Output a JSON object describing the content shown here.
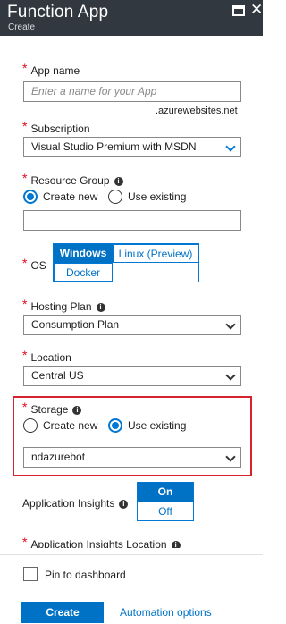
{
  "header": {
    "title": "Function App",
    "subtitle": "Create"
  },
  "app_name": {
    "label": "App name",
    "placeholder": "Enter a name for your App",
    "suffix": ".azurewebsites.net"
  },
  "subscription": {
    "label": "Subscription",
    "value": "Visual Studio Premium with MSDN"
  },
  "resource_group": {
    "label": "Resource Group",
    "create_new": "Create new",
    "use_existing": "Use existing",
    "selected": "create_new",
    "value": ""
  },
  "os": {
    "label": "OS",
    "options": [
      "Windows",
      "Linux (Preview)",
      "Docker"
    ],
    "selected": "Windows"
  },
  "hosting_plan": {
    "label": "Hosting Plan",
    "value": "Consumption Plan"
  },
  "location": {
    "label": "Location",
    "value": "Central US"
  },
  "storage": {
    "label": "Storage",
    "create_new": "Create new",
    "use_existing": "Use existing",
    "selected": "use_existing",
    "value": "ndazurebot"
  },
  "app_insights": {
    "label": "Application Insights",
    "on": "On",
    "off": "Off",
    "selected": "On"
  },
  "app_insights_location": {
    "label": "Application Insights Location"
  },
  "footer": {
    "pin_label": "Pin to dashboard",
    "create_label": "Create",
    "automation_label": "Automation options"
  },
  "colors": {
    "header_bg": "#32383f",
    "accent": "#0072c6",
    "required": "#e00b1c",
    "highlight_border": "#d7232f"
  }
}
